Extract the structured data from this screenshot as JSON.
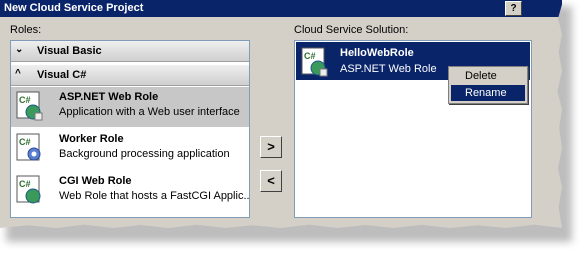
{
  "window": {
    "title": "New Cloud Service Project",
    "help_label": "?"
  },
  "roles": {
    "label": "Roles:",
    "groups": [
      {
        "label": "Visual Basic",
        "chevron": "⌄"
      },
      {
        "label": "Visual C#",
        "chevron": "^"
      }
    ],
    "items": [
      {
        "name": "ASP.NET Web Role",
        "description": "Application with a Web user interface",
        "icon": "web-role-icon"
      },
      {
        "name": "Worker Role",
        "description": "Background processing application",
        "icon": "worker-role-icon"
      },
      {
        "name": "CGI Web Role",
        "description": "Web Role that hosts a FastCGI Applic...",
        "icon": "cgi-role-icon"
      }
    ]
  },
  "buttons": {
    "add_label": ">",
    "remove_label": "<"
  },
  "solution": {
    "label": "Cloud Service Solution:",
    "items": [
      {
        "name": "HelloWebRole",
        "description": "ASP.NET Web Role",
        "icon": "web-role-icon"
      }
    ]
  },
  "context_menu": {
    "items": [
      "Delete",
      "Rename"
    ],
    "highlighted": "Rename"
  },
  "colors": {
    "selection": "#0a246a",
    "title_bar": "#0a246a",
    "dialog_face": "#d4d0c8"
  }
}
